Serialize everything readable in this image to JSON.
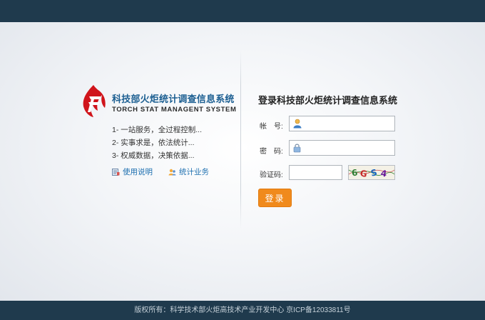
{
  "brand": {
    "name_cn": "科技部火炬统计调查信息系统",
    "name_en": "TORCH STAT MANAGENT SYSTEM"
  },
  "features": [
    "1- 一站服务，全过程控制...",
    "2- 实事求是，依法统计...",
    "3- 权威数据，决策依据..."
  ],
  "links": {
    "usage": "使用说明",
    "business": "统计业务"
  },
  "login": {
    "title": "登录科技部火炬统计调查信息系统",
    "account_label": "帐　号:",
    "password_label": "密　码:",
    "captcha_label": "验证码:",
    "account_value": "",
    "password_value": "",
    "captcha_value": "",
    "captcha_text": "6GS4",
    "submit_label": "登录"
  },
  "footer": {
    "copyright": "版权所有：科学技术部火炬高技术产业开发中心 京ICP备12033811号"
  },
  "colors": {
    "header_bar": "#1f3a4d",
    "brand_blue": "#1b5e91",
    "logo_red": "#d0141b",
    "login_button": "#f08a1c",
    "link_blue": "#1d6fb0"
  }
}
